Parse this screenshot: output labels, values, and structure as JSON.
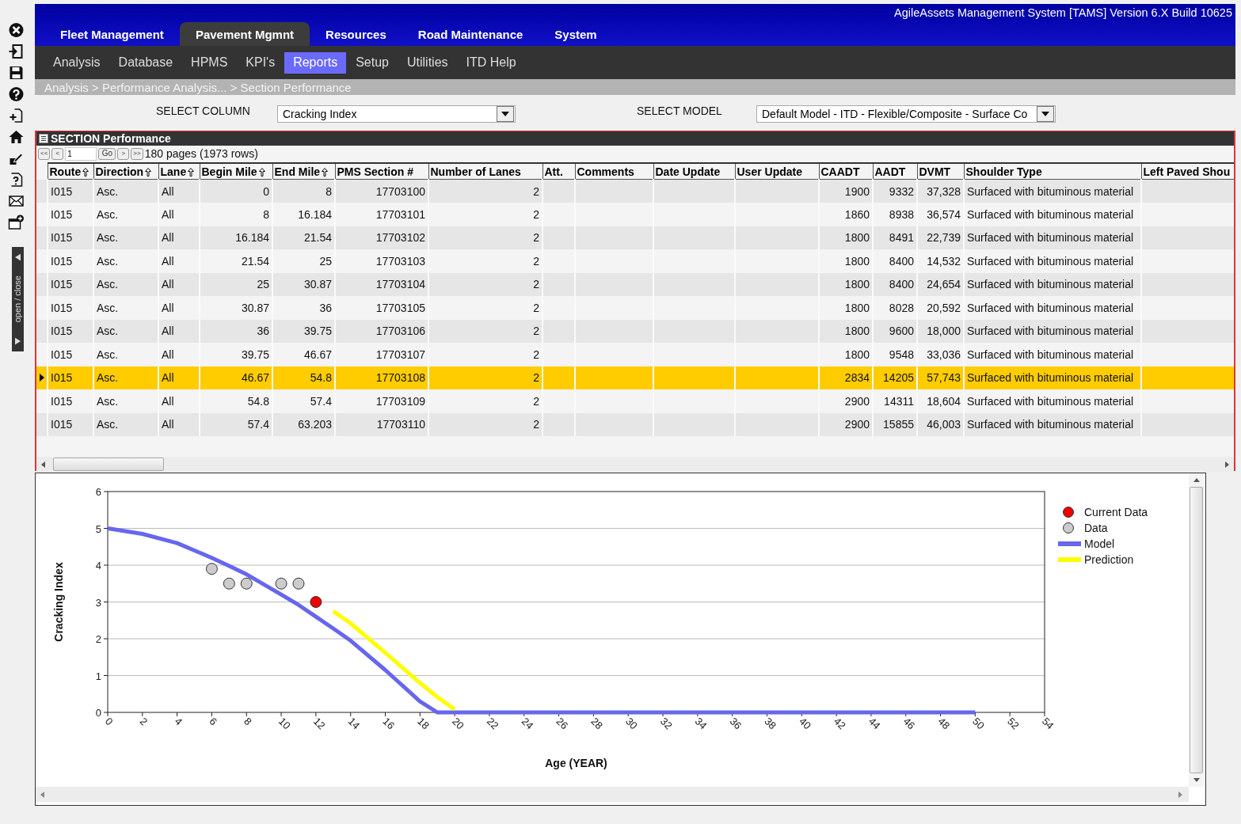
{
  "app_title": "AgileAssets Management System [TAMS] Version 6.X Build 10625",
  "side_panel": {
    "toggle_label": "open / close"
  },
  "main_tabs": [
    {
      "label": "Fleet Management",
      "selected": false
    },
    {
      "label": "Pavement Mgmnt",
      "selected": true
    },
    {
      "label": "Resources",
      "selected": false
    },
    {
      "label": "Road Maintenance",
      "selected": false
    },
    {
      "label": "System",
      "selected": false
    }
  ],
  "sub_tabs": [
    {
      "label": "Analysis",
      "selected": false
    },
    {
      "label": "Database",
      "selected": false
    },
    {
      "label": "HPMS",
      "selected": false
    },
    {
      "label": "KPI's",
      "selected": false
    },
    {
      "label": "Reports",
      "selected": true
    },
    {
      "label": "Setup",
      "selected": false
    },
    {
      "label": "Utilities",
      "selected": false
    },
    {
      "label": "ITD Help",
      "selected": false
    }
  ],
  "breadcrumb": "Analysis > Performance Analysis... > Section Performance",
  "filters": [
    {
      "label": "SELECT COLUMN",
      "value": "Cracking Index"
    },
    {
      "label": "SELECT MODEL",
      "value": "Default Model - ITD - Flexible/Composite - Surface Co"
    }
  ],
  "grid": {
    "title": "SECTION Performance",
    "pager": {
      "first": "<<",
      "prev": "<",
      "page": "1",
      "go": "Go",
      "next": ">",
      "last": ">>",
      "summary": "180 pages (1973 rows)"
    },
    "columns": [
      {
        "label": "Route",
        "kind": "text",
        "sortable": true
      },
      {
        "label": "Direction",
        "kind": "text",
        "sortable": true
      },
      {
        "label": "Lane",
        "kind": "text",
        "sortable": true
      },
      {
        "label": "Begin Mile",
        "kind": "number",
        "sortable": true
      },
      {
        "label": "End Mile",
        "kind": "number",
        "sortable": true
      },
      {
        "label": "PMS Section #",
        "kind": "number",
        "sortable": false
      },
      {
        "label": "Number of Lanes",
        "kind": "number",
        "sortable": false
      },
      {
        "label": "Att.",
        "kind": "text",
        "sortable": false
      },
      {
        "label": "Comments",
        "kind": "text",
        "sortable": false
      },
      {
        "label": "Date Update",
        "kind": "text",
        "sortable": false
      },
      {
        "label": "User Update",
        "kind": "text",
        "sortable": false
      },
      {
        "label": "CAADT",
        "kind": "number",
        "sortable": false
      },
      {
        "label": "AADT",
        "kind": "number",
        "sortable": false
      },
      {
        "label": "DVMT",
        "kind": "number",
        "sortable": false
      },
      {
        "label": "Shoulder Type",
        "kind": "text",
        "sortable": false
      },
      {
        "label": "Left Paved Shou",
        "kind": "text",
        "sortable": false
      }
    ],
    "rows": [
      {
        "selected": false,
        "cells": [
          "I015",
          "Asc.",
          "All",
          "0",
          "8",
          "17703100",
          "2",
          null,
          null,
          null,
          null,
          "1900",
          "9332",
          "37,328",
          "Surfaced with bituminous material",
          null
        ]
      },
      {
        "selected": false,
        "cells": [
          "I015",
          "Asc.",
          "All",
          "8",
          "16.184",
          "17703101",
          "2",
          null,
          null,
          null,
          null,
          "1860",
          "8938",
          "36,574",
          "Surfaced with bituminous material",
          null
        ]
      },
      {
        "selected": false,
        "cells": [
          "I015",
          "Asc.",
          "All",
          "16.184",
          "21.54",
          "17703102",
          "2",
          null,
          null,
          null,
          null,
          "1800",
          "8491",
          "22,739",
          "Surfaced with bituminous material",
          null
        ]
      },
      {
        "selected": false,
        "cells": [
          "I015",
          "Asc.",
          "All",
          "21.54",
          "25",
          "17703103",
          "2",
          null,
          null,
          null,
          null,
          "1800",
          "8400",
          "14,532",
          "Surfaced with bituminous material",
          null
        ]
      },
      {
        "selected": false,
        "cells": [
          "I015",
          "Asc.",
          "All",
          "25",
          "30.87",
          "17703104",
          "2",
          null,
          null,
          null,
          null,
          "1800",
          "8400",
          "24,654",
          "Surfaced with bituminous material",
          null
        ]
      },
      {
        "selected": false,
        "cells": [
          "I015",
          "Asc.",
          "All",
          "30.87",
          "36",
          "17703105",
          "2",
          null,
          null,
          null,
          null,
          "1800",
          "8028",
          "20,592",
          "Surfaced with bituminous material",
          null
        ]
      },
      {
        "selected": false,
        "cells": [
          "I015",
          "Asc.",
          "All",
          "36",
          "39.75",
          "17703106",
          "2",
          null,
          null,
          null,
          null,
          "1800",
          "9600",
          "18,000",
          "Surfaced with bituminous material",
          null
        ]
      },
      {
        "selected": false,
        "cells": [
          "I015",
          "Asc.",
          "All",
          "39.75",
          "46.67",
          "17703107",
          "2",
          null,
          null,
          null,
          null,
          "1800",
          "9548",
          "33,036",
          "Surfaced with bituminous material",
          null
        ]
      },
      {
        "selected": true,
        "cells": [
          "I015",
          "Asc.",
          "All",
          "46.67",
          "54.8",
          "17703108",
          "2",
          null,
          null,
          null,
          null,
          "2834",
          "14205",
          "57,743",
          "Surfaced with bituminous material",
          null
        ]
      },
      {
        "selected": false,
        "cells": [
          "I015",
          "Asc.",
          "All",
          "54.8",
          "57.4",
          "17703109",
          "2",
          null,
          null,
          null,
          null,
          "2900",
          "14311",
          "18,604",
          "Surfaced with bituminous material",
          null
        ]
      },
      {
        "selected": false,
        "cells": [
          "I015",
          "Asc.",
          "All",
          "57.4",
          "63.203",
          "17703110",
          "2",
          null,
          null,
          null,
          null,
          "2900",
          "15855",
          "46,003",
          "Surfaced with bituminous material",
          null
        ]
      }
    ]
  },
  "chart": {
    "chart_data": {
      "type": "line",
      "xlabel": "Age (YEAR)",
      "ylabel": "Cracking Index",
      "x": [
        0,
        2,
        4,
        6,
        7,
        8,
        10,
        11,
        12,
        13,
        14,
        16,
        18,
        19,
        20,
        50
      ],
      "series": [
        {
          "name": "Current Data",
          "type": "scatter",
          "color": "#ee0000",
          "values": [
            null,
            null,
            null,
            null,
            null,
            null,
            null,
            null,
            3.0,
            null,
            null,
            null,
            null,
            null,
            null,
            null
          ]
        },
        {
          "name": "Data",
          "type": "scatter",
          "color": "#cccccc",
          "values": [
            null,
            null,
            null,
            3.9,
            3.5,
            3.5,
            3.5,
            3.5,
            null,
            null,
            null,
            null,
            null,
            null,
            null,
            null
          ]
        },
        {
          "name": "Model",
          "type": "line",
          "color": "#6666ee",
          "values": [
            5.0,
            4.85,
            4.6,
            4.2,
            3.98,
            3.75,
            3.2,
            2.92,
            2.6,
            2.28,
            1.95,
            1.15,
            0.3,
            0,
            0,
            0
          ]
        },
        {
          "name": "Prediction",
          "type": "line",
          "color": "#ffff00",
          "values": [
            null,
            null,
            null,
            null,
            null,
            null,
            null,
            null,
            null,
            2.75,
            2.42,
            1.62,
            0.8,
            0.42,
            0.08,
            null
          ]
        }
      ],
      "xlim": [
        0,
        54
      ],
      "ylim": [
        0,
        6
      ],
      "xticks": [
        0,
        2,
        4,
        6,
        8,
        10,
        12,
        14,
        16,
        18,
        20,
        22,
        24,
        26,
        28,
        30,
        32,
        34,
        36,
        38,
        40,
        42,
        44,
        46,
        48,
        50,
        52,
        54
      ],
      "yticks": [
        0,
        1,
        2,
        3,
        4,
        5,
        6
      ],
      "grid": true,
      "legend": true
    }
  }
}
